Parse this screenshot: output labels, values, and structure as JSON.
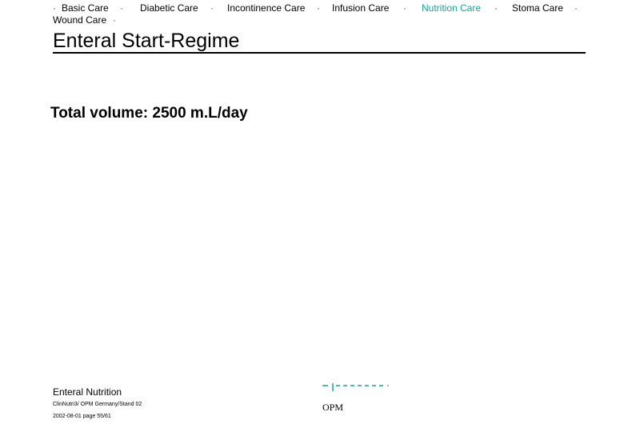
{
  "nav": {
    "separator": "·",
    "items": [
      {
        "label": "Basic Care",
        "active": false
      },
      {
        "label": "Diabetic Care",
        "active": false
      },
      {
        "label": "Incontinence Care",
        "active": false
      },
      {
        "label": "Infusion Care",
        "active": false
      },
      {
        "label": "Nutrition Care",
        "active": true
      },
      {
        "label": "Stoma Care",
        "active": false
      },
      {
        "label": "Wound Care",
        "active": false
      }
    ],
    "active_color": "#1aa39a"
  },
  "page": {
    "title": "Enteral Start-Regime",
    "subtitle": "Total volume: 2500 m.L/day"
  },
  "footer": {
    "section": "Enteral Nutrition",
    "reference": "ClinNutri3/ OPM Germany/Stand 02",
    "date_page": "2002-08-01   page 55/61",
    "logo_text": "OPM",
    "logo_color": "#1aa39a"
  }
}
